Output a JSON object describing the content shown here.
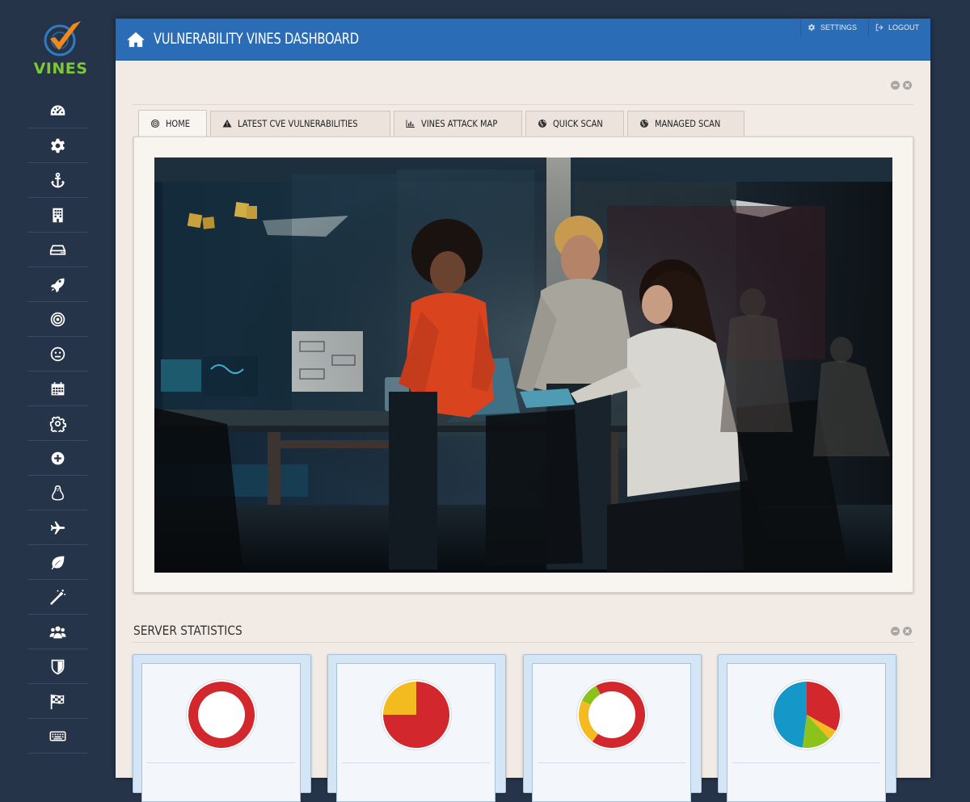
{
  "app": {
    "logo_text": "VINES",
    "title": "VULNERABILITY VINES DASHBOARD"
  },
  "header_links": {
    "settings": "SETTINGS",
    "logout": "LOGOUT"
  },
  "sidebar": {
    "items": [
      {
        "icon": "dashboard-icon"
      },
      {
        "icon": "gear-icon"
      },
      {
        "icon": "anchor-icon"
      },
      {
        "icon": "building-icon"
      },
      {
        "icon": "hard-drive-icon"
      },
      {
        "icon": "rocket-icon"
      },
      {
        "icon": "target-icon"
      },
      {
        "icon": "meh-face-icon"
      },
      {
        "icon": "calendar-icon"
      },
      {
        "icon": "cog-outline-icon"
      },
      {
        "icon": "plus-circle-icon"
      },
      {
        "icon": "linux-icon"
      },
      {
        "icon": "plane-icon"
      },
      {
        "icon": "leaf-icon"
      },
      {
        "icon": "magic-wand-icon"
      },
      {
        "icon": "users-icon"
      },
      {
        "icon": "shield-icon"
      },
      {
        "icon": "flag-checkered-icon"
      },
      {
        "icon": "keyboard-icon"
      }
    ]
  },
  "tabs": [
    {
      "label": "HOME",
      "icon": "target-icon",
      "active": true
    },
    {
      "label": "LATEST CVE VULNERABILITIES",
      "icon": "warning-icon",
      "active": false
    },
    {
      "label": "VINES ATTACK MAP",
      "icon": "bar-chart-icon",
      "active": false
    },
    {
      "label": "QUICK SCAN",
      "icon": "globe-icon",
      "active": false
    },
    {
      "label": "MANAGED SCAN",
      "icon": "globe-icon",
      "active": false
    }
  ],
  "stats": {
    "title": "SERVER STATISTICS",
    "cards": [
      {
        "type": "donut",
        "slices": [
          {
            "value": 1,
            "color": "#d1272d"
          }
        ]
      },
      {
        "type": "pie",
        "slices": [
          {
            "value": 0.75,
            "color": "#d1272d"
          },
          {
            "value": 0.25,
            "color": "#f4bb20"
          }
        ]
      },
      {
        "type": "donut",
        "slices": [
          {
            "value": 0.6,
            "color": "#d1272d"
          },
          {
            "value": 0.22,
            "color": "#f4bb20"
          },
          {
            "value": 0.1,
            "color": "#8cc21c"
          },
          {
            "value": 0.08,
            "color": "#d1272d"
          }
        ]
      },
      {
        "type": "pie",
        "slices": [
          {
            "value": 0.33,
            "color": "#d1272d"
          },
          {
            "value": 0.05,
            "color": "#f4bb20"
          },
          {
            "value": 0.14,
            "color": "#8cc21c"
          },
          {
            "value": 0.48,
            "color": "#1597c8"
          }
        ]
      }
    ]
  },
  "colors": {
    "header_blue": "#2a6db6",
    "sidebar_bg": "#26344a",
    "logo_green": "#7ec832",
    "logo_orange": "#f08a1c"
  }
}
